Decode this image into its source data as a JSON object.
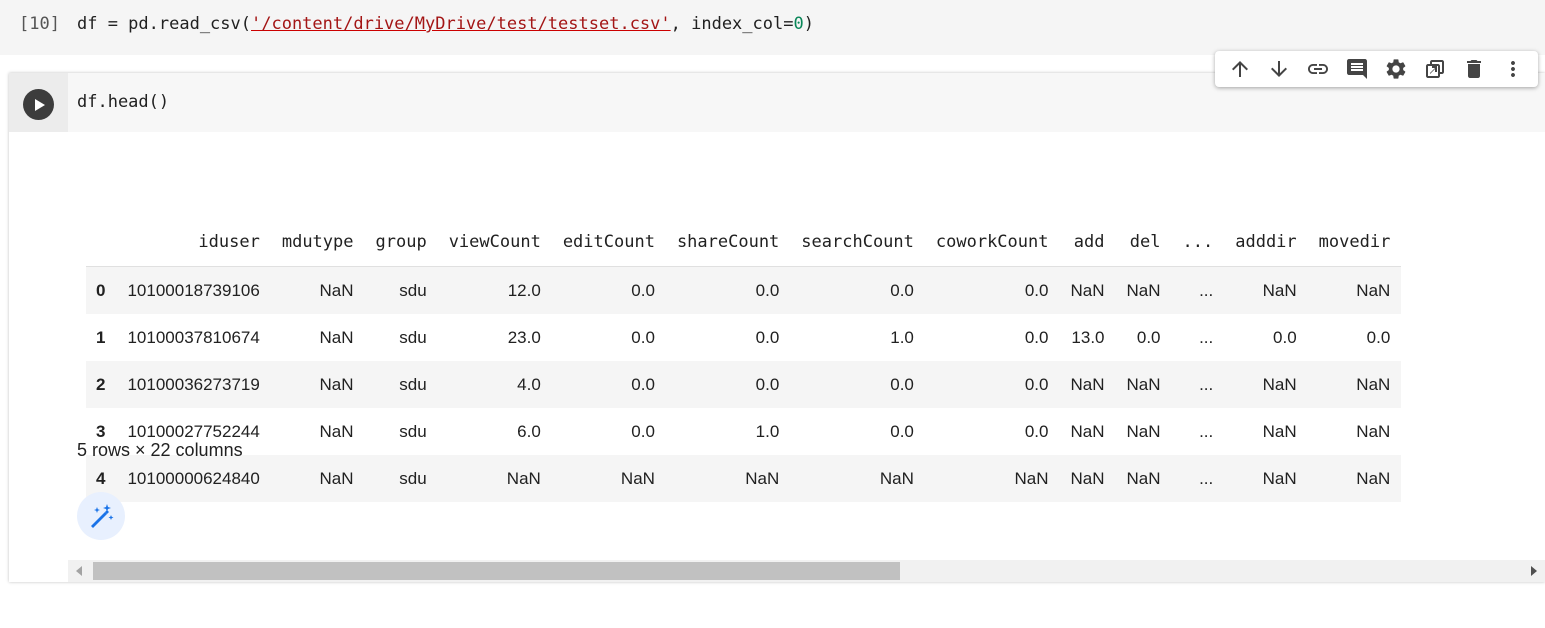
{
  "prev_cell": {
    "exec_count": "[10]",
    "code_prefix": "df = pd.read_csv(",
    "code_string": "'/content/drive/MyDrive/test/testset.csv'",
    "code_mid": ", index_col=",
    "code_num": "0",
    "code_suffix": ")"
  },
  "active_cell": {
    "code": "df.head()"
  },
  "toolbar": {
    "icons": [
      "arrow-up-icon",
      "arrow-down-icon",
      "link-icon",
      "comment-icon",
      "gear-icon",
      "mirror-cell-icon",
      "trash-icon",
      "more-vert-icon"
    ]
  },
  "dataframe": {
    "columns": [
      "",
      "iduser",
      "mdutype",
      "group",
      "viewCount",
      "editCount",
      "shareCount",
      "searchCount",
      "coworkCount",
      "add",
      "del",
      "...",
      "adddir",
      "movedir"
    ],
    "rows": [
      [
        "0",
        "10100018739106",
        "NaN",
        "sdu",
        "12.0",
        "0.0",
        "0.0",
        "0.0",
        "0.0",
        "NaN",
        "NaN",
        "...",
        "NaN",
        "NaN"
      ],
      [
        "1",
        "10100037810674",
        "NaN",
        "sdu",
        "23.0",
        "0.0",
        "0.0",
        "1.0",
        "0.0",
        "13.0",
        "0.0",
        "...",
        "0.0",
        "0.0"
      ],
      [
        "2",
        "10100036273719",
        "NaN",
        "sdu",
        "4.0",
        "0.0",
        "0.0",
        "0.0",
        "0.0",
        "NaN",
        "NaN",
        "...",
        "NaN",
        "NaN"
      ],
      [
        "3",
        "10100027752244",
        "NaN",
        "sdu",
        "6.0",
        "0.0",
        "1.0",
        "0.0",
        "0.0",
        "NaN",
        "NaN",
        "...",
        "NaN",
        "NaN"
      ],
      [
        "4",
        "10100000624840",
        "NaN",
        "sdu",
        "NaN",
        "NaN",
        "NaN",
        "NaN",
        "NaN",
        "NaN",
        "NaN",
        "...",
        "NaN",
        "NaN"
      ]
    ],
    "shape_note": "5 rows × 22 columns"
  },
  "colors": {
    "string": "#a31515",
    "number": "#098658",
    "run_button": "#3c3c3c",
    "magic_bg": "#e8f0fe",
    "magic_icon": "#1a73e8"
  }
}
